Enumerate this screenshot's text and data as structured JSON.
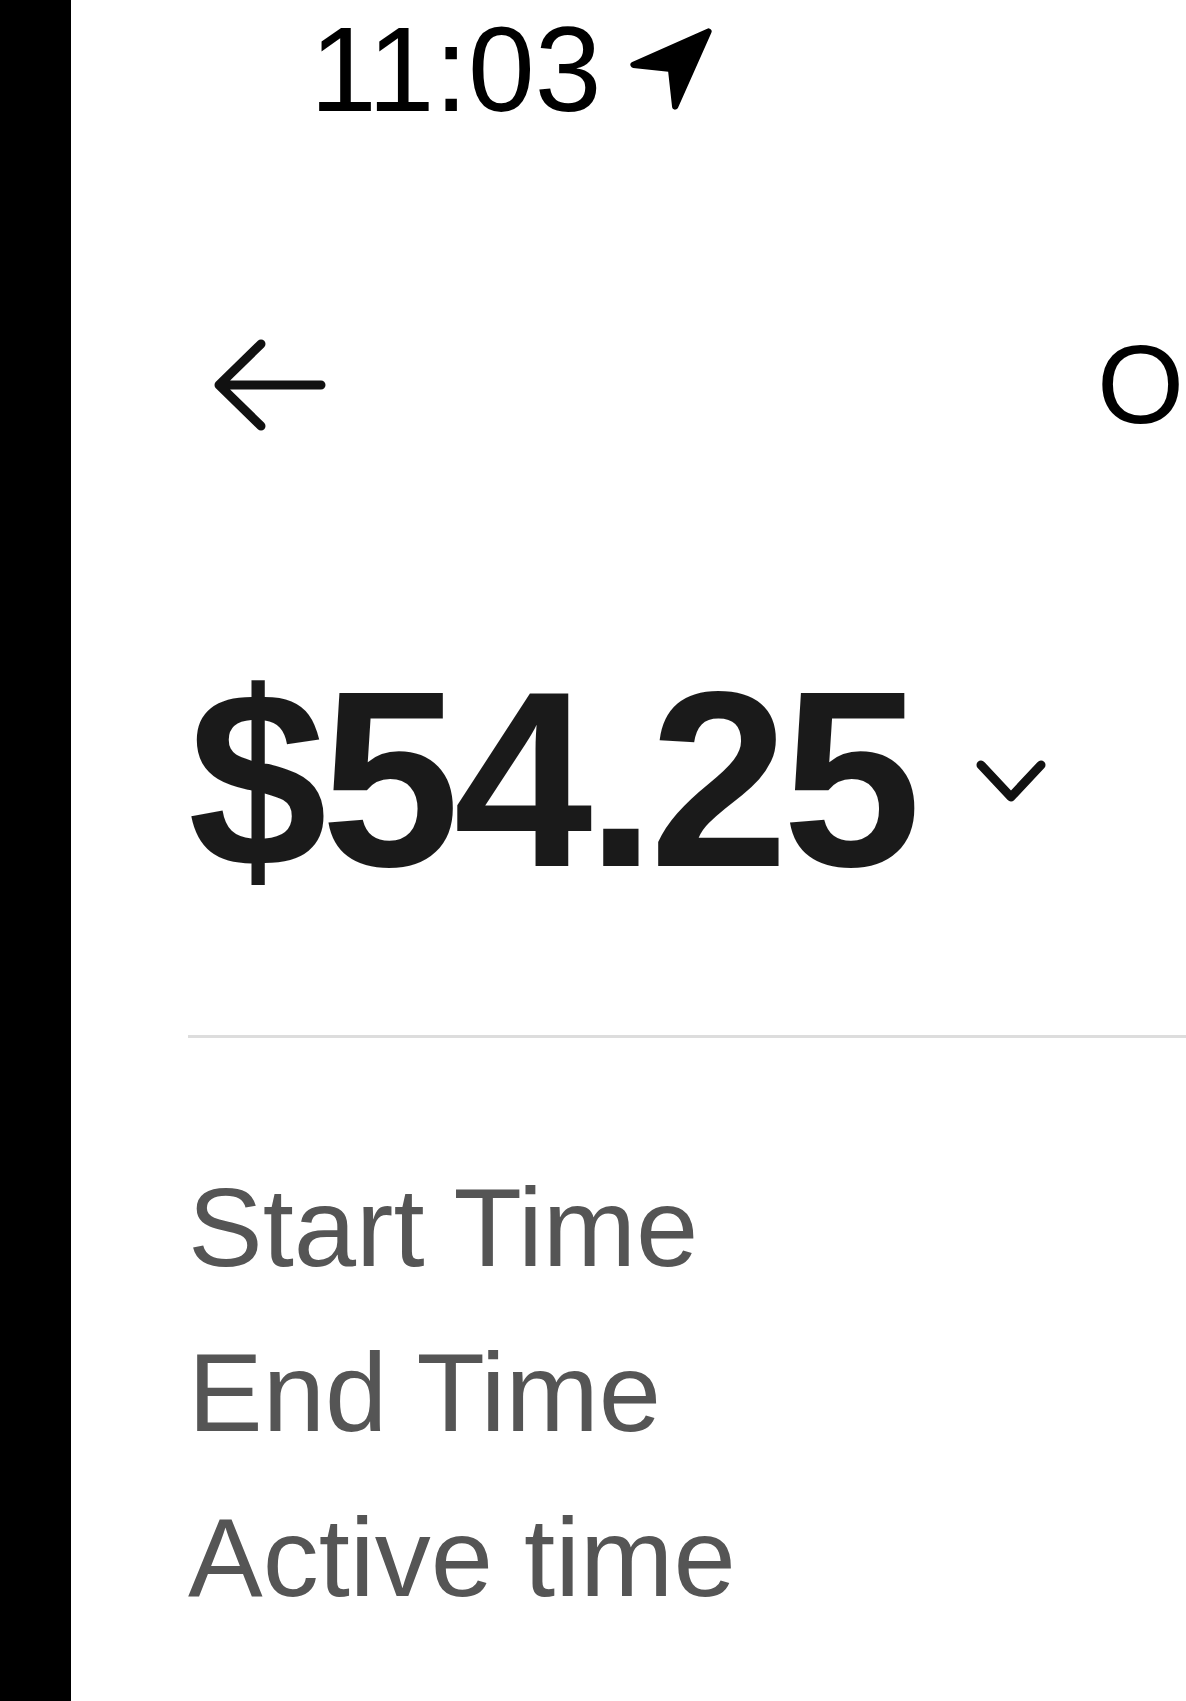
{
  "status_bar": {
    "time": "11:03"
  },
  "header": {
    "title": "O"
  },
  "amount": {
    "value": "$54.25",
    "expanded": false
  },
  "details": [
    {
      "label": "Start Time"
    },
    {
      "label": "End Time"
    },
    {
      "label": "Active time"
    }
  ]
}
